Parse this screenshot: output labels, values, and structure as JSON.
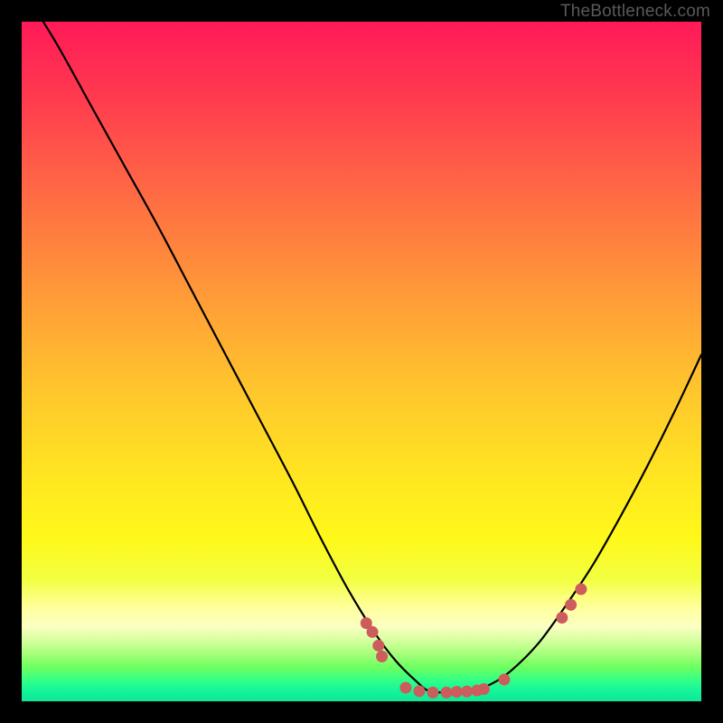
{
  "watermark": "TheBottleneck.com",
  "colors": {
    "background": "#000000",
    "curve": "#000000",
    "markers": "#cd5c5c",
    "watermark": "#595959"
  },
  "chart_data": {
    "type": "line",
    "title": "",
    "xlabel": "",
    "ylabel": "",
    "xlim": [
      0,
      100
    ],
    "ylim": [
      0,
      100
    ],
    "grid": false,
    "legend": false,
    "note": "Axes are unlabeled. X/Y values are approximate (percent of plot area). Y is plotted with 0 at bottom. Curve represents a bottleneck/deviation-style V-shape with minimum near x≈60; pink markers highlight near-minimum and two bands on the slopes.",
    "series": [
      {
        "name": "curve",
        "x": [
          0,
          5,
          10,
          15,
          20,
          25,
          30,
          35,
          40,
          44,
          48,
          52,
          55,
          58,
          60,
          63,
          66,
          69,
          72,
          76,
          80,
          84,
          88,
          92,
          96,
          100
        ],
        "y": [
          105,
          97,
          88,
          79,
          70,
          60.5,
          51,
          41.5,
          32,
          24,
          16.5,
          10,
          6,
          3,
          1.5,
          1.3,
          1.5,
          2.5,
          4.5,
          8.5,
          14,
          20,
          27,
          34.5,
          42.5,
          51
        ]
      }
    ],
    "markers": [
      {
        "x": 50.7,
        "y": 11.5
      },
      {
        "x": 51.6,
        "y": 10.2
      },
      {
        "x": 52.5,
        "y": 8.2
      },
      {
        "x": 53.0,
        "y": 6.6
      },
      {
        "x": 56.5,
        "y": 2.0
      },
      {
        "x": 58.5,
        "y": 1.5
      },
      {
        "x": 60.5,
        "y": 1.3
      },
      {
        "x": 62.5,
        "y": 1.3
      },
      {
        "x": 64.0,
        "y": 1.4
      },
      {
        "x": 65.5,
        "y": 1.45
      },
      {
        "x": 67.0,
        "y": 1.6
      },
      {
        "x": 68.0,
        "y": 1.8
      },
      {
        "x": 71.0,
        "y": 3.2
      },
      {
        "x": 79.5,
        "y": 12.3
      },
      {
        "x": 80.8,
        "y": 14.2
      },
      {
        "x": 82.3,
        "y": 16.5
      }
    ]
  }
}
